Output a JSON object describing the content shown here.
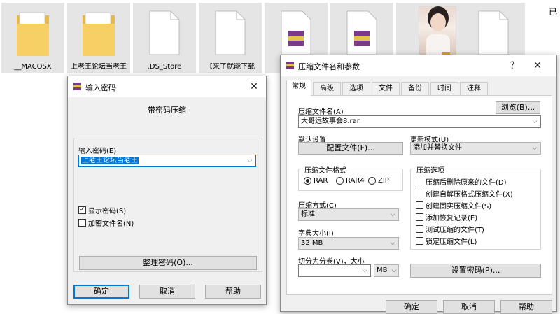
{
  "explorer": {
    "files": [
      {
        "name": "__MACOSX",
        "type": "folder"
      },
      {
        "name": "上老王论坛当老王",
        "type": "folder"
      },
      {
        "name": ".DS_Store",
        "type": "doc"
      },
      {
        "name": "【来了就能下载",
        "type": "doc"
      },
      {
        "name": "",
        "type": "rar"
      },
      {
        "name": "",
        "type": "rar"
      },
      {
        "name": "",
        "type": "rar"
      },
      {
        "name": "",
        "type": "photo"
      },
      {
        "name": "",
        "type": "doc"
      }
    ],
    "corner_text": "已"
  },
  "password_dialog": {
    "title": "输入密码",
    "heading": "带密码压缩",
    "password_label": "输入密码(E)",
    "password_value": "上老王论坛当老王",
    "show_password_label": "显示密码(S)",
    "encrypt_names_label": "加密文件名(N)",
    "organize_button": "整理密码(O)...",
    "ok_button": "确定",
    "cancel_button": "取消",
    "help_button": "帮助",
    "show_password_checked": true,
    "encrypt_names_checked": false
  },
  "archive_dialog": {
    "title": "压缩文件名和参数",
    "help_glyph": "?",
    "close_glyph": "✕",
    "tabs": [
      "常规",
      "高级",
      "选项",
      "文件",
      "备份",
      "时间",
      "注释"
    ],
    "active_tab": 0,
    "archive_name_label": "压缩文件名(A)",
    "browse_button": "浏览(B)...",
    "archive_name_value": "大哥远故事会8.rar",
    "default_settings_label": "默认设置",
    "profiles_button": "配置文件(F)...",
    "update_mode_label": "更新模式(U)",
    "update_mode_value": "添加并替换文件",
    "format_group_title": "压缩文件格式",
    "formats": [
      {
        "label": "RAR",
        "selected": true
      },
      {
        "label": "RAR4",
        "selected": false
      },
      {
        "label": "ZIP",
        "selected": false
      }
    ],
    "method_label": "压缩方式(C)",
    "method_value": "标准",
    "dict_label": "字典大小(I)",
    "dict_value": "32 MB",
    "split_label": "切分为分卷(V)，大小",
    "split_value": "",
    "split_unit": "MB",
    "options_group_title": "压缩选项",
    "options": [
      {
        "label": "压缩后删除原来的文件(D)",
        "checked": false
      },
      {
        "label": "创建自解压格式压缩文件(X)",
        "checked": false
      },
      {
        "label": "创建固实压缩文件(S)",
        "checked": false
      },
      {
        "label": "添加恢复记录(E)",
        "checked": false
      },
      {
        "label": "测试压缩的文件(T)",
        "checked": false
      },
      {
        "label": "锁定压缩文件(L)",
        "checked": false
      }
    ],
    "set_password_button": "设置密码(P)...",
    "ok_button": "确定",
    "cancel_button": "取消",
    "help_button": "帮助"
  }
}
